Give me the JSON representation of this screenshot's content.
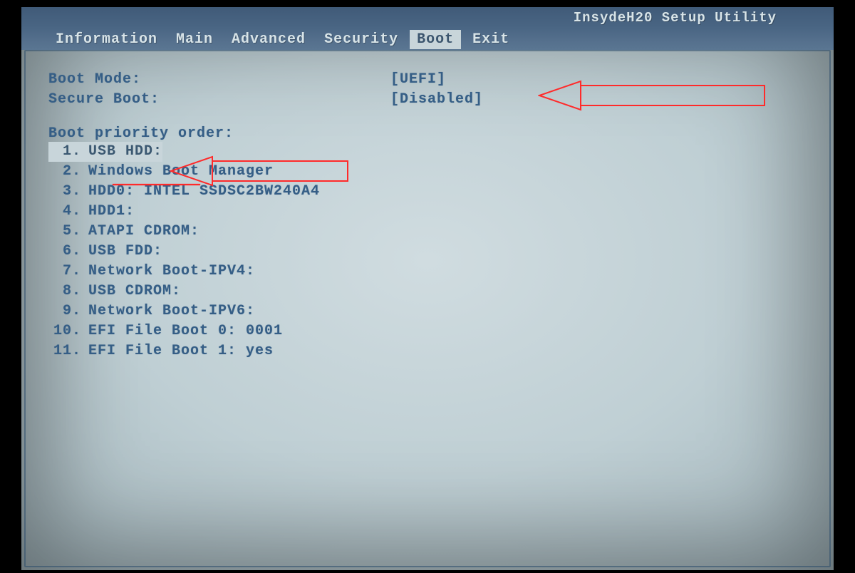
{
  "title": "InsydeH20 Setup Utility",
  "menu": {
    "items": [
      {
        "label": "Information"
      },
      {
        "label": "Main"
      },
      {
        "label": "Advanced"
      },
      {
        "label": "Security"
      },
      {
        "label": "Boot",
        "active": true
      },
      {
        "label": "Exit"
      }
    ]
  },
  "settings": {
    "boot_mode_label": "Boot Mode:",
    "boot_mode_value": "[UEFI]",
    "secure_boot_label": "Secure Boot:",
    "secure_boot_value": "[Disabled]"
  },
  "boot_order": {
    "heading": "Boot priority order:",
    "items": [
      {
        "n": " 1.",
        "text": "USB HDD:",
        "selected": true
      },
      {
        "n": " 2.",
        "text": "Windows Boot Manager"
      },
      {
        "n": " 3.",
        "text": "HDD0: INTEL SSDSC2BW240A4"
      },
      {
        "n": " 4.",
        "text": "HDD1:"
      },
      {
        "n": " 5.",
        "text": "ATAPI CDROM:"
      },
      {
        "n": " 6.",
        "text": "USB FDD:"
      },
      {
        "n": " 7.",
        "text": "Network Boot-IPV4:"
      },
      {
        "n": " 8.",
        "text": "USB CDROM:"
      },
      {
        "n": " 9.",
        "text": "Network Boot-IPV6:"
      },
      {
        "n": "10.",
        "text": "EFI File Boot 0: 0001"
      },
      {
        "n": "11.",
        "text": "EFI File Boot 1: yes"
      }
    ]
  },
  "annotations": {
    "arrow_color": "#ff2a2a"
  }
}
